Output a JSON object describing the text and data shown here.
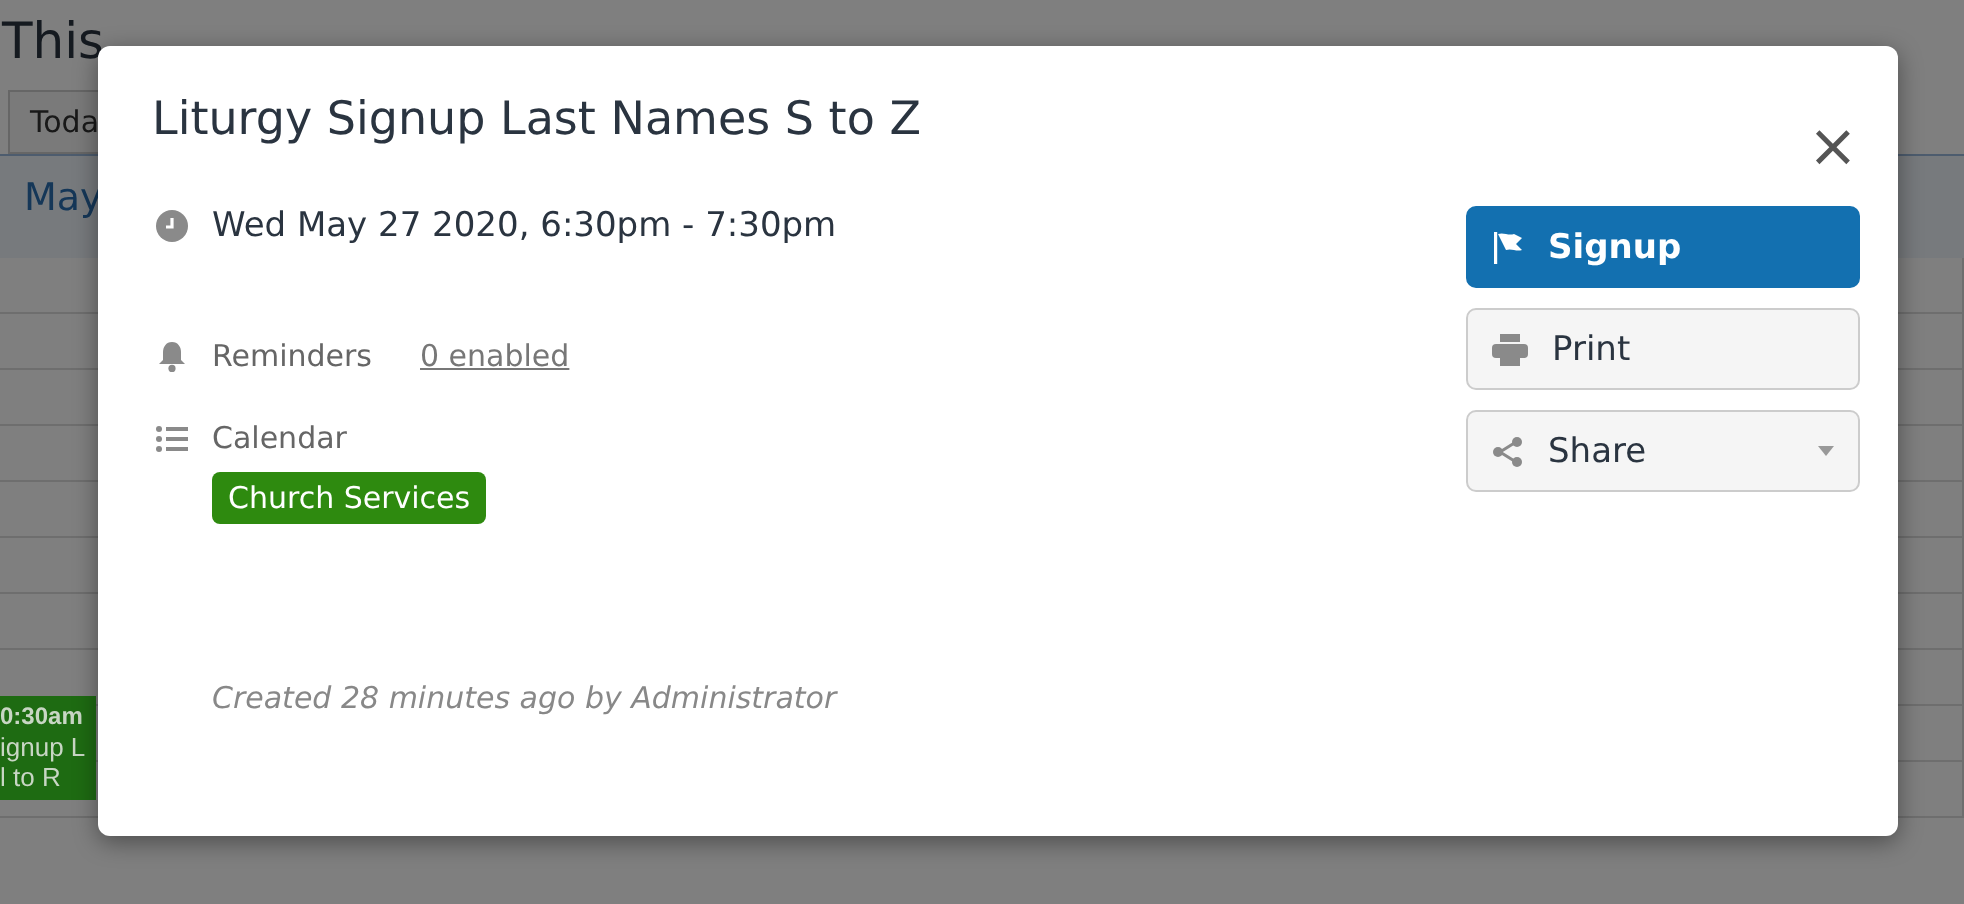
{
  "page": {
    "title": "This",
    "today_button": "Toda",
    "month_label": "May",
    "event": {
      "time": "0:30am",
      "lines": [
        "ignup L",
        "l to R"
      ],
      "color": "#1e6b12"
    }
  },
  "dialog": {
    "title": "Liturgy Signup Last Names S to Z",
    "close": "×",
    "when": "Wed May 27 2020, 6:30pm - 7:30pm",
    "reminders": {
      "label": "Reminders",
      "link": "0 enabled"
    },
    "calendar": {
      "label": "Calendar",
      "tag": "Church Services",
      "color": "#2e8a0f"
    },
    "created": "Created 28 minutes ago by Administrator",
    "actions": [
      {
        "kind": "signup",
        "label": "Signup",
        "primary": true
      },
      {
        "kind": "print",
        "label": "Print",
        "primary": false
      },
      {
        "kind": "share",
        "label": "Share",
        "primary": false,
        "dropdown": true
      }
    ]
  }
}
